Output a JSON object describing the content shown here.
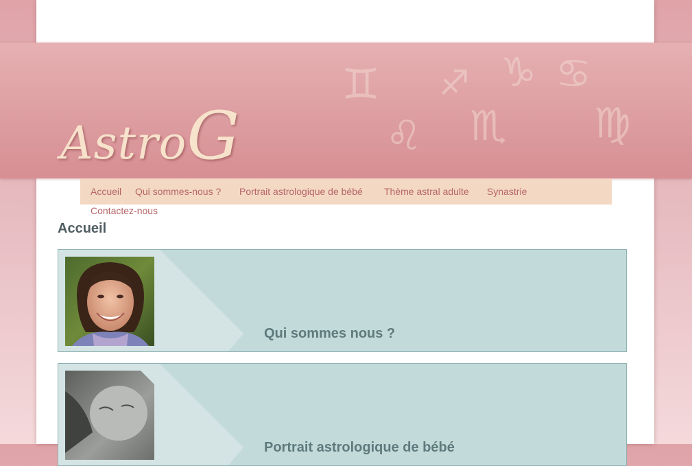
{
  "site": {
    "logo_main": "Astro",
    "logo_initial": "G"
  },
  "banner": {
    "zodiac_symbols": [
      "♊",
      "♐",
      "♑",
      "♋",
      "♌",
      "♏",
      "♍"
    ]
  },
  "nav": {
    "items": [
      "Accueil",
      "Qui sommes-nous ?",
      "Portrait astrologique de bébé",
      "Thème astral adulte",
      "Synastrie",
      "Contactez-nous"
    ]
  },
  "main": {
    "page_title": "Accueil",
    "cards": [
      {
        "title": "Qui sommes nous ?",
        "image": "portrait-photo"
      },
      {
        "title": "Portrait astrologique de bébé",
        "image": "baby-photo"
      }
    ]
  },
  "colors": {
    "banner": "#dd9ea1",
    "nav_bg": "#f3d8c4",
    "nav_text": "#b66668",
    "card_bg": "#c3dadb",
    "card_title": "#5e7a7c"
  }
}
